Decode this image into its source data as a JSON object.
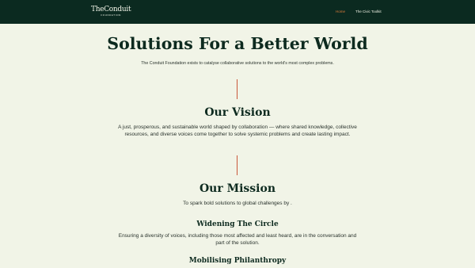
{
  "header": {
    "logo_main": "TheConduit",
    "logo_sub": "FOUNDATION",
    "nav": [
      {
        "label": "Home",
        "active": true
      },
      {
        "label": "The Civic Toolkit",
        "active": false
      }
    ]
  },
  "hero": {
    "title": "Solutions For a Better World",
    "subtitle": "The Conduit Foundation exists to catalyse collaborative solutions to the world's most complex problems."
  },
  "vision": {
    "title": "Our Vision",
    "text": "A just, prosperous, and sustainable world shaped by collaboration — where shared knowledge, collective resources, and diverse voices come together to solve systemic problems and create lasting impact."
  },
  "mission": {
    "title": "Our Mission",
    "text": "To spark bold solutions to global challenges by .",
    "items": [
      {
        "title": "Widening The Circle",
        "text": "Ensuring a diversity of voices, including those most affected and least heard, are in the conversation and part of the solution."
      },
      {
        "title": "Mobilising Philanthropy"
      }
    ]
  },
  "colors": {
    "header_bg": "#0b2a20",
    "page_bg": "#f1f4e7",
    "accent": "#d97a3a",
    "divider": "#c9573a"
  }
}
